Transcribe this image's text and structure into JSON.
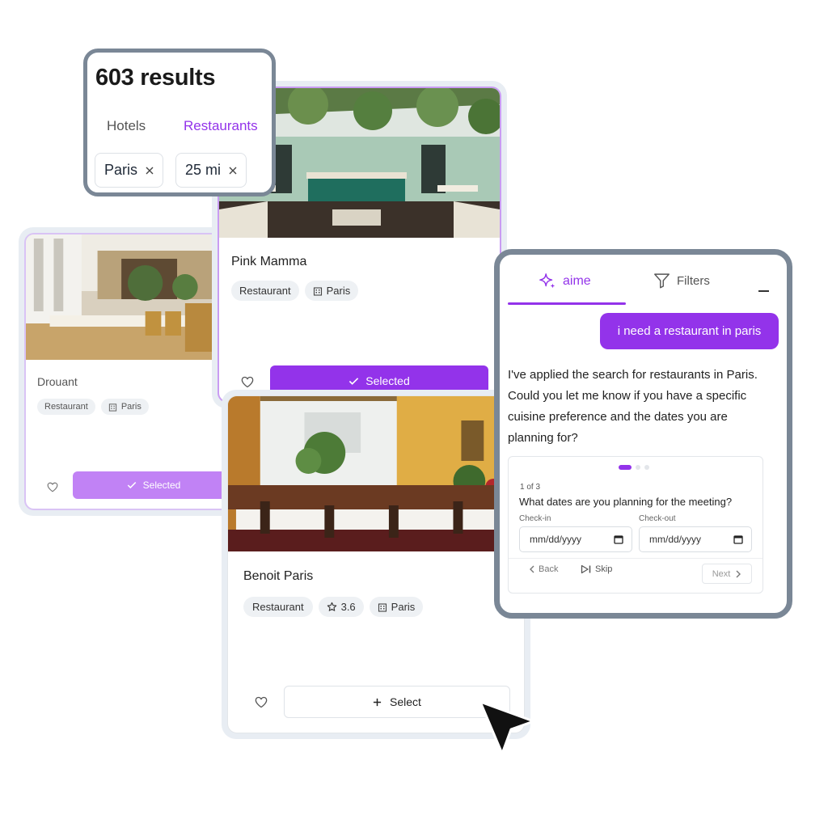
{
  "colors": {
    "accent": "#9333ea",
    "accent_light": "#c182f5",
    "frame": "#7a8796"
  },
  "results": {
    "count": "603 results",
    "tabs": {
      "hotels": "Hotels",
      "restaurants": "Restaurants",
      "active": "Restaurants"
    },
    "filters": [
      {
        "label": "Paris"
      },
      {
        "label": "25 mi"
      }
    ]
  },
  "cards": {
    "drouant": {
      "name": "Drouant",
      "type": "Restaurant",
      "city": "Paris",
      "button": "Selected"
    },
    "pink_mamma": {
      "name": "Pink Mamma",
      "type": "Restaurant",
      "city": "Paris",
      "button": "Selected"
    },
    "benoit": {
      "name": "Benoit Paris",
      "type": "Restaurant",
      "rating": "3.6",
      "city": "Paris",
      "button": "Select"
    }
  },
  "aime": {
    "tabs": {
      "aime": "aime",
      "filters": "Filters",
      "active": "aime"
    },
    "user_message": "i need a restaurant in paris",
    "assistant_message": "I've applied the search for restaurants in Paris. Could you let me know if you have a specific cuisine preference and the dates you are planning for?",
    "question": {
      "step": "1 of 3",
      "total_steps": 3,
      "current_step": 1,
      "text": "What dates are you planning for the meeting?",
      "checkin_label": "Check-in",
      "checkin_placeholder": "mm/dd/yyyy",
      "checkout_label": "Check-out",
      "checkout_placeholder": "mm/dd/yyyy",
      "back": "Back",
      "skip": "Skip",
      "next": "Next"
    }
  },
  "icons": [
    "check-icon",
    "plus-icon",
    "heart-icon",
    "star-icon",
    "building-icon",
    "close-icon",
    "sparkle-icon",
    "filter-icon",
    "calendar-icon",
    "chevron-left-icon",
    "chevron-right-icon",
    "skip-icon",
    "cursor-arrow-icon"
  ]
}
